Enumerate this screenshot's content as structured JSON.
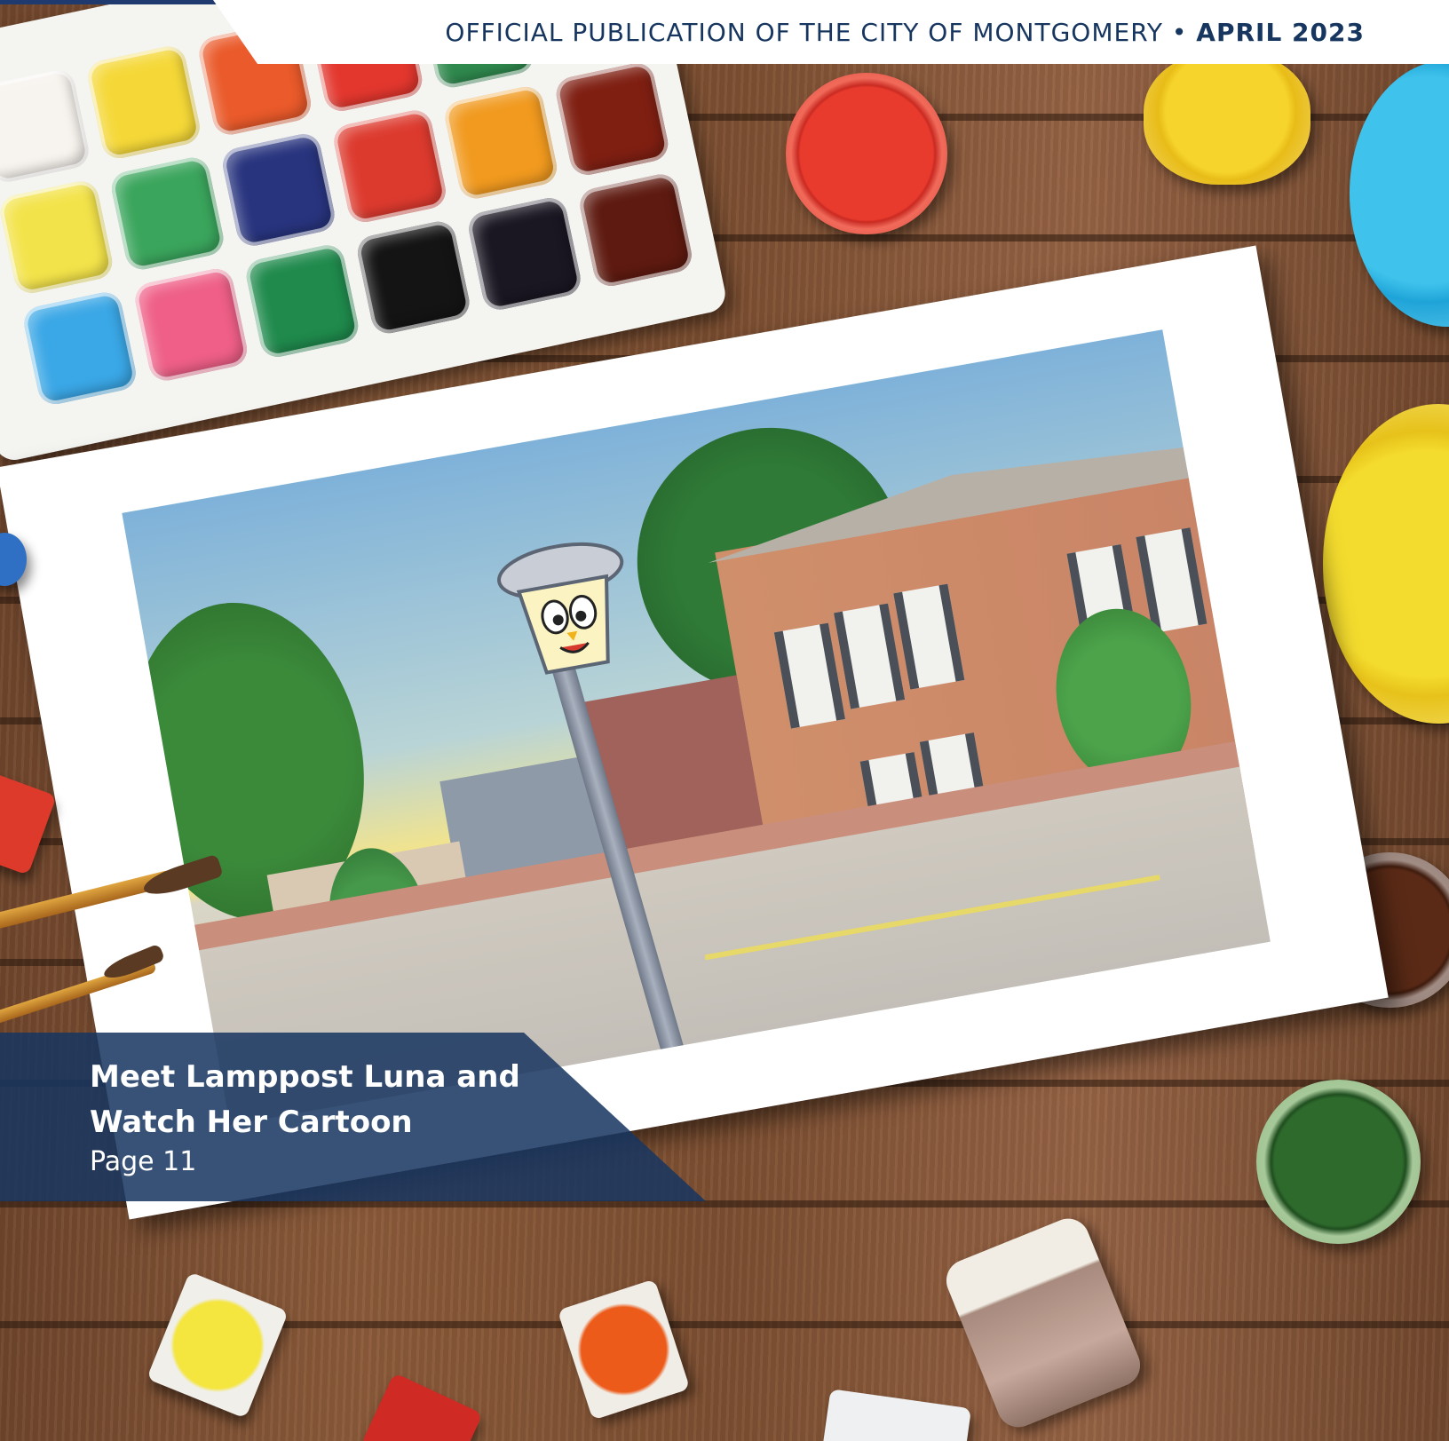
{
  "header": {
    "publication": "OFFICIAL PUBLICATION OF THE CITY OF MONTGOMERY",
    "separator": " • ",
    "issue_date": "APRIL 2023"
  },
  "feature": {
    "title": "Meet Lamppost Luna and Watch Her Cartoon",
    "page_ref": "Page 11"
  },
  "colors": {
    "brand_blue": "#16365f",
    "banner_blue": "#173661",
    "accent_red": "#c8222c"
  },
  "palette_colors": [
    "#f7f3ee",
    "#f5d838",
    "#ea5a2a",
    "#e3372e",
    "#2f8a4e",
    "#a3201c",
    "#f3e34a",
    "#3aa55c",
    "#28347e",
    "#dd3a2e",
    "#f19a1f",
    "#7f1f12",
    "#3aa7e6",
    "#ef5f87",
    "#1f8a4c",
    "#141414",
    "#1a1622",
    "#5e1a10"
  ]
}
